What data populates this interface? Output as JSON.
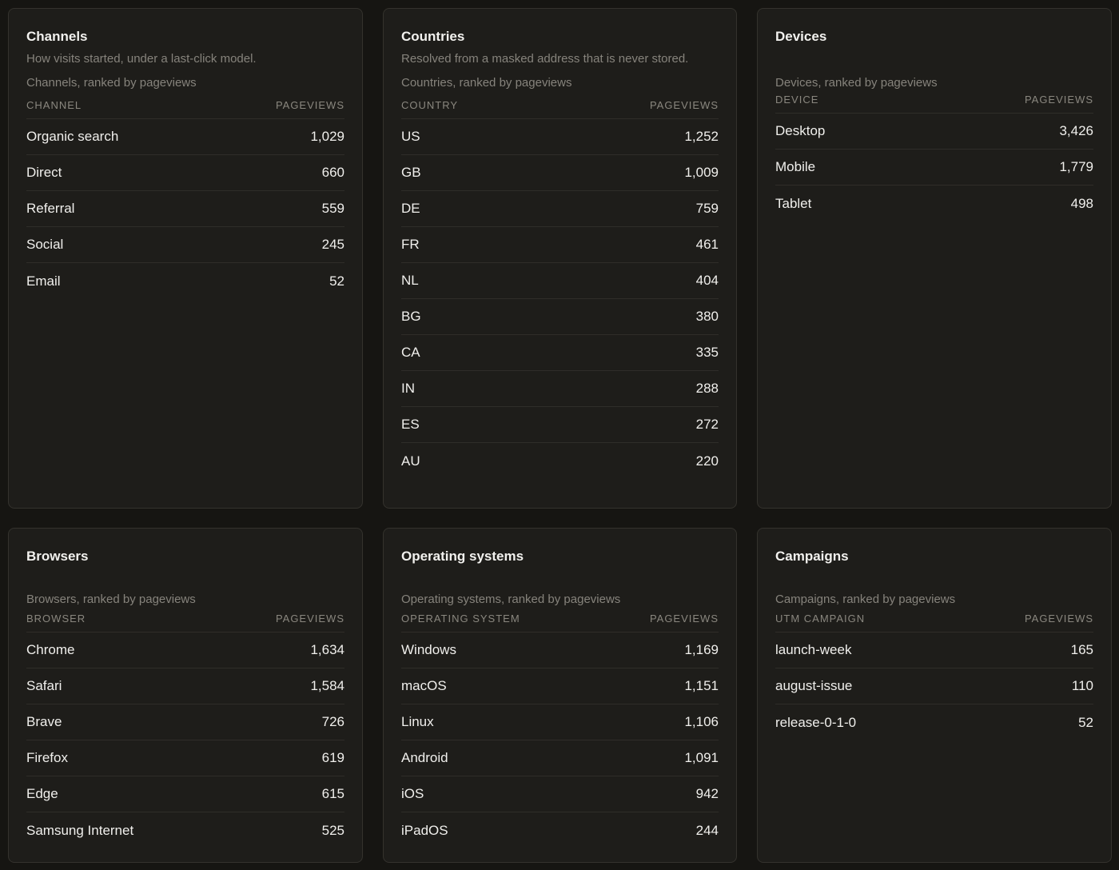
{
  "channels": {
    "title": "Channels",
    "description": "How visits started, under a last-click model.",
    "hint": "Channels, ranked by pageviews",
    "col_label": "CHANNEL",
    "col_value": "PAGEVIEWS",
    "rows": [
      {
        "label": "Organic search",
        "value": "1,029"
      },
      {
        "label": "Direct",
        "value": "660"
      },
      {
        "label": "Referral",
        "value": "559"
      },
      {
        "label": "Social",
        "value": "245"
      },
      {
        "label": "Email",
        "value": "52"
      }
    ]
  },
  "countries": {
    "title": "Countries",
    "description": "Resolved from a masked address that is never stored.",
    "hint": "Countries, ranked by pageviews",
    "col_label": "COUNTRY",
    "col_value": "PAGEVIEWS",
    "rows": [
      {
        "label": "US",
        "value": "1,252"
      },
      {
        "label": "GB",
        "value": "1,009"
      },
      {
        "label": "DE",
        "value": "759"
      },
      {
        "label": "FR",
        "value": "461"
      },
      {
        "label": "NL",
        "value": "404"
      },
      {
        "label": "BG",
        "value": "380"
      },
      {
        "label": "CA",
        "value": "335"
      },
      {
        "label": "IN",
        "value": "288"
      },
      {
        "label": "ES",
        "value": "272"
      },
      {
        "label": "AU",
        "value": "220"
      }
    ]
  },
  "devices": {
    "title": "Devices",
    "hint": "Devices, ranked by pageviews",
    "col_label": "DEVICE",
    "col_value": "PAGEVIEWS",
    "rows": [
      {
        "label": "Desktop",
        "value": "3,426"
      },
      {
        "label": "Mobile",
        "value": "1,779"
      },
      {
        "label": "Tablet",
        "value": "498"
      }
    ]
  },
  "browsers": {
    "title": "Browsers",
    "hint": "Browsers, ranked by pageviews",
    "col_label": "BROWSER",
    "col_value": "PAGEVIEWS",
    "rows": [
      {
        "label": "Chrome",
        "value": "1,634"
      },
      {
        "label": "Safari",
        "value": "1,584"
      },
      {
        "label": "Brave",
        "value": "726"
      },
      {
        "label": "Firefox",
        "value": "619"
      },
      {
        "label": "Edge",
        "value": "615"
      },
      {
        "label": "Samsung Internet",
        "value": "525"
      }
    ]
  },
  "operating_systems": {
    "title": "Operating systems",
    "hint": "Operating systems, ranked by pageviews",
    "col_label": "OPERATING SYSTEM",
    "col_value": "PAGEVIEWS",
    "rows": [
      {
        "label": "Windows",
        "value": "1,169"
      },
      {
        "label": "macOS",
        "value": "1,151"
      },
      {
        "label": "Linux",
        "value": "1,106"
      },
      {
        "label": "Android",
        "value": "1,091"
      },
      {
        "label": "iOS",
        "value": "942"
      },
      {
        "label": "iPadOS",
        "value": "244"
      }
    ]
  },
  "campaigns": {
    "title": "Campaigns",
    "hint": "Campaigns, ranked by pageviews",
    "col_label": "UTM CAMPAIGN",
    "col_value": "PAGEVIEWS",
    "rows": [
      {
        "label": "launch-week",
        "value": "165"
      },
      {
        "label": "august-issue",
        "value": "110"
      },
      {
        "label": "release-0-1-0",
        "value": "52"
      }
    ]
  }
}
